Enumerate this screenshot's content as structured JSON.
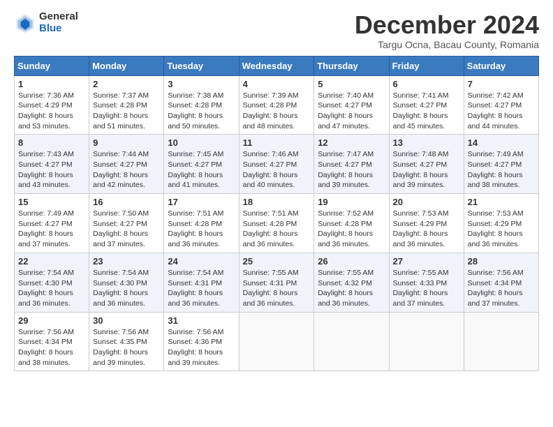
{
  "logo": {
    "general": "General",
    "blue": "Blue"
  },
  "title": "December 2024",
  "subtitle": "Targu Ocna, Bacau County, Romania",
  "days_of_week": [
    "Sunday",
    "Monday",
    "Tuesday",
    "Wednesday",
    "Thursday",
    "Friday",
    "Saturday"
  ],
  "weeks": [
    [
      {
        "day": "1",
        "sunrise": "Sunrise: 7:36 AM",
        "sunset": "Sunset: 4:29 PM",
        "daylight": "Daylight: 8 hours and 53 minutes."
      },
      {
        "day": "2",
        "sunrise": "Sunrise: 7:37 AM",
        "sunset": "Sunset: 4:28 PM",
        "daylight": "Daylight: 8 hours and 51 minutes."
      },
      {
        "day": "3",
        "sunrise": "Sunrise: 7:38 AM",
        "sunset": "Sunset: 4:28 PM",
        "daylight": "Daylight: 8 hours and 50 minutes."
      },
      {
        "day": "4",
        "sunrise": "Sunrise: 7:39 AM",
        "sunset": "Sunset: 4:28 PM",
        "daylight": "Daylight: 8 hours and 48 minutes."
      },
      {
        "day": "5",
        "sunrise": "Sunrise: 7:40 AM",
        "sunset": "Sunset: 4:27 PM",
        "daylight": "Daylight: 8 hours and 47 minutes."
      },
      {
        "day": "6",
        "sunrise": "Sunrise: 7:41 AM",
        "sunset": "Sunset: 4:27 PM",
        "daylight": "Daylight: 8 hours and 45 minutes."
      },
      {
        "day": "7",
        "sunrise": "Sunrise: 7:42 AM",
        "sunset": "Sunset: 4:27 PM",
        "daylight": "Daylight: 8 hours and 44 minutes."
      }
    ],
    [
      {
        "day": "8",
        "sunrise": "Sunrise: 7:43 AM",
        "sunset": "Sunset: 4:27 PM",
        "daylight": "Daylight: 8 hours and 43 minutes."
      },
      {
        "day": "9",
        "sunrise": "Sunrise: 7:44 AM",
        "sunset": "Sunset: 4:27 PM",
        "daylight": "Daylight: 8 hours and 42 minutes."
      },
      {
        "day": "10",
        "sunrise": "Sunrise: 7:45 AM",
        "sunset": "Sunset: 4:27 PM",
        "daylight": "Daylight: 8 hours and 41 minutes."
      },
      {
        "day": "11",
        "sunrise": "Sunrise: 7:46 AM",
        "sunset": "Sunset: 4:27 PM",
        "daylight": "Daylight: 8 hours and 40 minutes."
      },
      {
        "day": "12",
        "sunrise": "Sunrise: 7:47 AM",
        "sunset": "Sunset: 4:27 PM",
        "daylight": "Daylight: 8 hours and 39 minutes."
      },
      {
        "day": "13",
        "sunrise": "Sunrise: 7:48 AM",
        "sunset": "Sunset: 4:27 PM",
        "daylight": "Daylight: 8 hours and 39 minutes."
      },
      {
        "day": "14",
        "sunrise": "Sunrise: 7:49 AM",
        "sunset": "Sunset: 4:27 PM",
        "daylight": "Daylight: 8 hours and 38 minutes."
      }
    ],
    [
      {
        "day": "15",
        "sunrise": "Sunrise: 7:49 AM",
        "sunset": "Sunset: 4:27 PM",
        "daylight": "Daylight: 8 hours and 37 minutes."
      },
      {
        "day": "16",
        "sunrise": "Sunrise: 7:50 AM",
        "sunset": "Sunset: 4:27 PM",
        "daylight": "Daylight: 8 hours and 37 minutes."
      },
      {
        "day": "17",
        "sunrise": "Sunrise: 7:51 AM",
        "sunset": "Sunset: 4:28 PM",
        "daylight": "Daylight: 8 hours and 36 minutes."
      },
      {
        "day": "18",
        "sunrise": "Sunrise: 7:51 AM",
        "sunset": "Sunset: 4:28 PM",
        "daylight": "Daylight: 8 hours and 36 minutes."
      },
      {
        "day": "19",
        "sunrise": "Sunrise: 7:52 AM",
        "sunset": "Sunset: 4:28 PM",
        "daylight": "Daylight: 8 hours and 36 minutes."
      },
      {
        "day": "20",
        "sunrise": "Sunrise: 7:53 AM",
        "sunset": "Sunset: 4:29 PM",
        "daylight": "Daylight: 8 hours and 36 minutes."
      },
      {
        "day": "21",
        "sunrise": "Sunrise: 7:53 AM",
        "sunset": "Sunset: 4:29 PM",
        "daylight": "Daylight: 8 hours and 36 minutes."
      }
    ],
    [
      {
        "day": "22",
        "sunrise": "Sunrise: 7:54 AM",
        "sunset": "Sunset: 4:30 PM",
        "daylight": "Daylight: 8 hours and 36 minutes."
      },
      {
        "day": "23",
        "sunrise": "Sunrise: 7:54 AM",
        "sunset": "Sunset: 4:30 PM",
        "daylight": "Daylight: 8 hours and 36 minutes."
      },
      {
        "day": "24",
        "sunrise": "Sunrise: 7:54 AM",
        "sunset": "Sunset: 4:31 PM",
        "daylight": "Daylight: 8 hours and 36 minutes."
      },
      {
        "day": "25",
        "sunrise": "Sunrise: 7:55 AM",
        "sunset": "Sunset: 4:31 PM",
        "daylight": "Daylight: 8 hours and 36 minutes."
      },
      {
        "day": "26",
        "sunrise": "Sunrise: 7:55 AM",
        "sunset": "Sunset: 4:32 PM",
        "daylight": "Daylight: 8 hours and 36 minutes."
      },
      {
        "day": "27",
        "sunrise": "Sunrise: 7:55 AM",
        "sunset": "Sunset: 4:33 PM",
        "daylight": "Daylight: 8 hours and 37 minutes."
      },
      {
        "day": "28",
        "sunrise": "Sunrise: 7:56 AM",
        "sunset": "Sunset: 4:34 PM",
        "daylight": "Daylight: 8 hours and 37 minutes."
      }
    ],
    [
      {
        "day": "29",
        "sunrise": "Sunrise: 7:56 AM",
        "sunset": "Sunset: 4:34 PM",
        "daylight": "Daylight: 8 hours and 38 minutes."
      },
      {
        "day": "30",
        "sunrise": "Sunrise: 7:56 AM",
        "sunset": "Sunset: 4:35 PM",
        "daylight": "Daylight: 8 hours and 39 minutes."
      },
      {
        "day": "31",
        "sunrise": "Sunrise: 7:56 AM",
        "sunset": "Sunset: 4:36 PM",
        "daylight": "Daylight: 8 hours and 39 minutes."
      },
      null,
      null,
      null,
      null
    ]
  ]
}
